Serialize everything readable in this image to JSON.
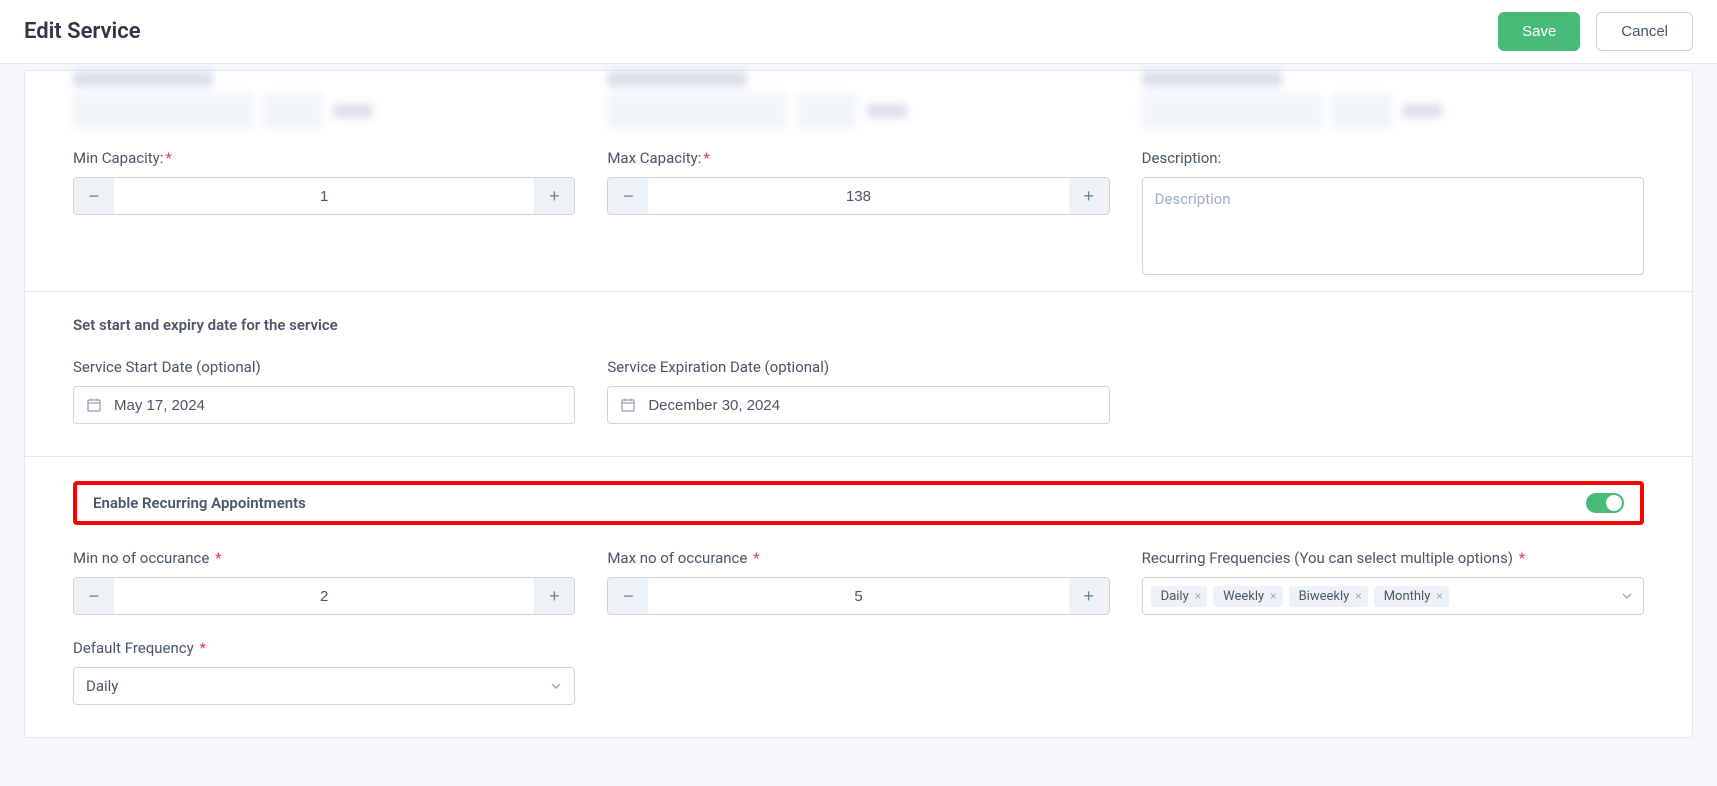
{
  "header": {
    "title": "Edit Service",
    "save_label": "Save",
    "cancel_label": "Cancel"
  },
  "capacity": {
    "min_label": "Min Capacity:",
    "min_value": "1",
    "max_label": "Max Capacity:",
    "max_value": "138",
    "description_label": "Description:",
    "description_placeholder": "Description",
    "description_value": ""
  },
  "dates": {
    "section_title": "Set start and expiry date for the service",
    "start_label": "Service Start Date (optional)",
    "start_value": "May 17, 2024",
    "expiry_label": "Service Expiration Date (optional)",
    "expiry_value": "December 30, 2024"
  },
  "recurring": {
    "title": "Enable Recurring Appointments",
    "enabled": true,
    "min_occ_label": "Min no of occurance",
    "min_occ_value": "2",
    "max_occ_label": "Max no of occurance",
    "max_occ_value": "5",
    "frequencies_label": "Recurring Frequencies (You can select multiple options)",
    "frequencies": [
      "Daily",
      "Weekly",
      "Biweekly",
      "Monthly"
    ],
    "default_freq_label": "Default Frequency",
    "default_freq_value": "Daily"
  },
  "icons": {
    "minus": "−",
    "plus": "+",
    "times": "×"
  }
}
